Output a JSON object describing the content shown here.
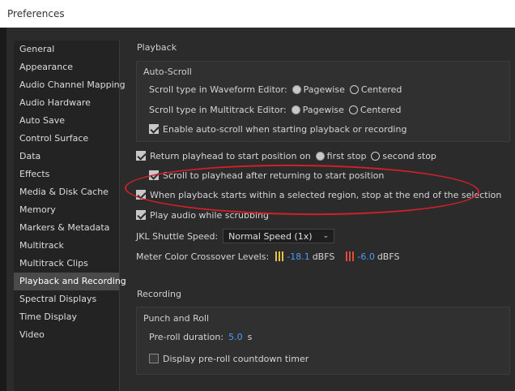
{
  "window": {
    "title": "Preferences"
  },
  "sidebar": {
    "items": [
      {
        "label": "General"
      },
      {
        "label": "Appearance"
      },
      {
        "label": "Audio Channel Mapping"
      },
      {
        "label": "Audio Hardware"
      },
      {
        "label": "Auto Save"
      },
      {
        "label": "Control Surface"
      },
      {
        "label": "Data"
      },
      {
        "label": "Effects"
      },
      {
        "label": "Media & Disk Cache"
      },
      {
        "label": "Memory"
      },
      {
        "label": "Markers & Metadata"
      },
      {
        "label": "Multitrack"
      },
      {
        "label": "Multitrack Clips"
      },
      {
        "label": "Playback and Recording"
      },
      {
        "label": "Spectral Displays"
      },
      {
        "label": "Time Display"
      },
      {
        "label": "Video"
      }
    ],
    "selected": "Playback and Recording"
  },
  "playback": {
    "title": "Playback",
    "autoscroll": {
      "title": "Auto-Scroll",
      "waveform_label": "Scroll type in Waveform Editor:",
      "multitrack_label": "Scroll type in Multitrack Editor:",
      "pagewise": "Pagewise",
      "centered": "Centered",
      "enable_label": "Enable auto-scroll when starting playback or recording"
    },
    "return_label": "Return playhead to start position on",
    "first_stop": "first stop",
    "second_stop": "second stop",
    "scroll_label": "Scroll to playhead after returning to start position",
    "stop_label": "When playback starts within a selected region, stop at the end of the selection",
    "play_audio_label": "Play audio while scrubbing",
    "jkl_label": "JKL Shuttle Speed:",
    "jkl_value": "Normal Speed (1x)",
    "meter_label": "Meter Color Crossover Levels:",
    "meter_yellow_value": "-18.1",
    "meter_red_value": "-6.0",
    "dbfs": "dBFS"
  },
  "recording": {
    "title": "Recording",
    "punch": {
      "title": "Punch and Roll",
      "preroll_label": "Pre-roll duration:",
      "preroll_value": "5.0",
      "preroll_unit": "s",
      "countdown_label": "Display pre-roll countdown timer"
    }
  },
  "colors": {
    "accent": "#4a9bff",
    "annotation": "#d0202a"
  }
}
